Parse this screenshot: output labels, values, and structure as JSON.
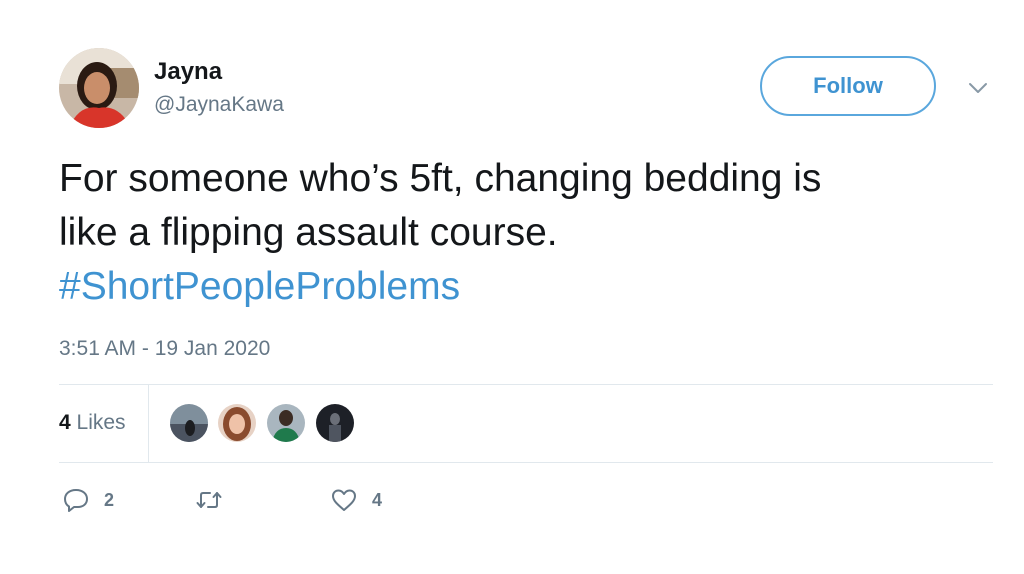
{
  "tweet": {
    "author_name": "Jayna",
    "author_handle": "@JaynaKawa",
    "follow_label": "Follow",
    "text_line1": "For someone who’s 5ft, changing bedding is",
    "text_line2": "like a flipping assault course.",
    "hashtag": "#ShortPeopleProblems",
    "timestamp": "3:51 AM - 19 Jan 2020"
  },
  "stats": {
    "likes_count": "4",
    "likes_label": "Likes"
  },
  "actions": {
    "reply_count": "2",
    "retweet_count": "",
    "like_count": "4"
  },
  "icons": {
    "reply": "reply-icon",
    "retweet": "retweet-icon",
    "like": "heart-icon",
    "caret": "chevron-down-icon"
  },
  "colors": {
    "accent": "#3f93d1",
    "text": "#14171a",
    "muted": "#657786",
    "divider": "#e1e8ed"
  }
}
